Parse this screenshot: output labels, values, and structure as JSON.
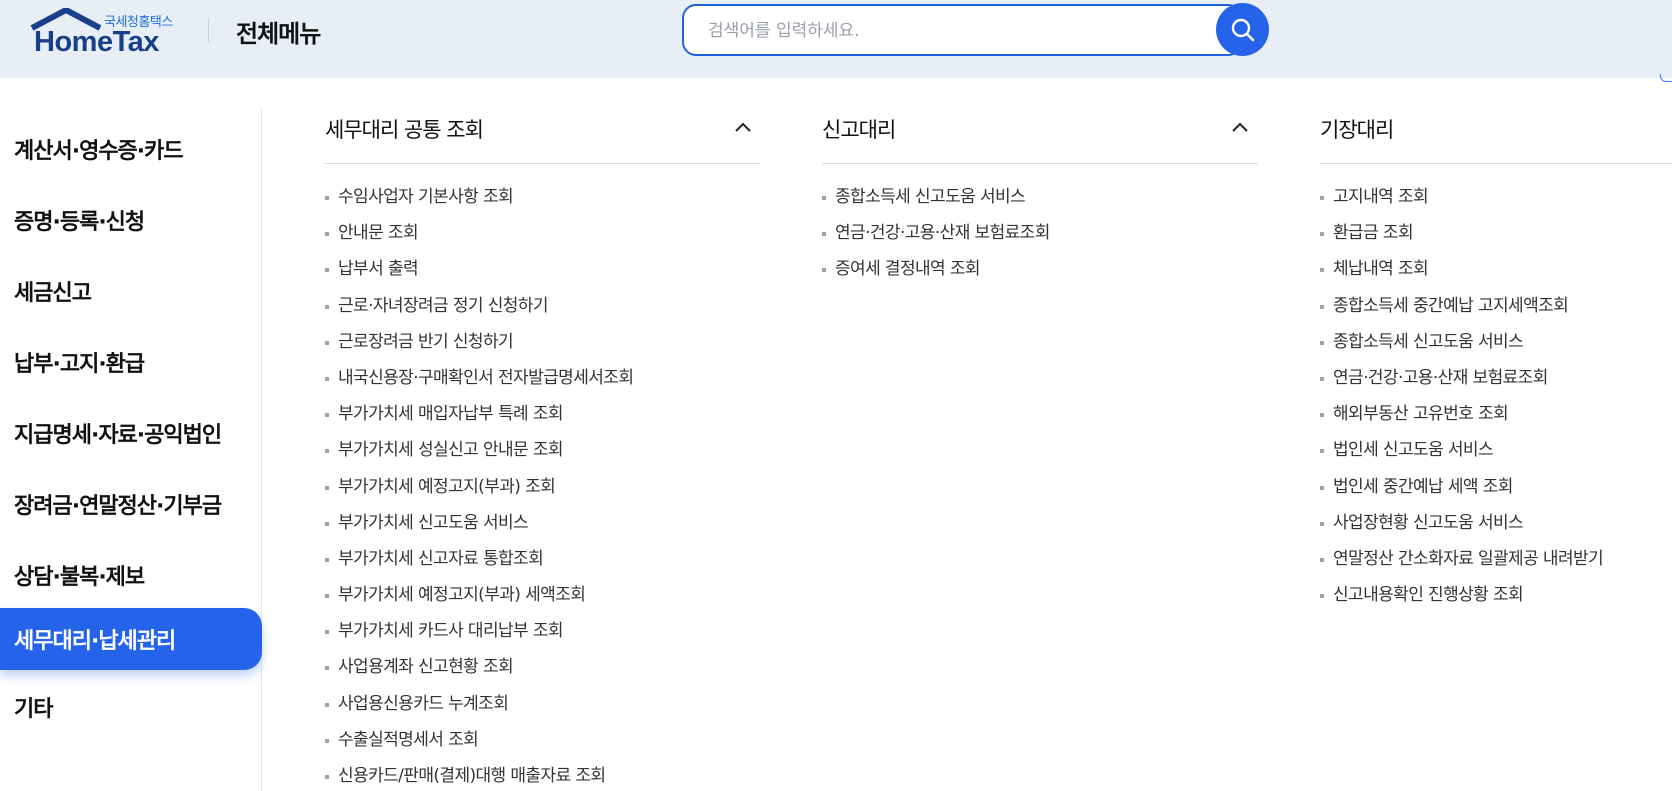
{
  "header": {
    "logo_sub": "국세청홈택스",
    "logo_main": "HomeTax",
    "title": "전체메뉴",
    "search_placeholder": "검색어를 입력하세요.",
    "search_icon": "search-icon"
  },
  "nav": {
    "items": [
      {
        "label": "계산서·영수증·카드"
      },
      {
        "label": "증명·등록·신청"
      },
      {
        "label": "세금신고"
      },
      {
        "label": "납부·고지·환급"
      },
      {
        "label": "지급명세·자료·공익법인"
      },
      {
        "label": "장려금·연말정산·기부금"
      },
      {
        "label": "상담·불복·제보"
      },
      {
        "label": "세무대리·납세관리",
        "active": true
      },
      {
        "label": "기타"
      }
    ],
    "active_color": "#2563eb"
  },
  "columns": [
    {
      "title": "세무대리 공통 조회",
      "expanded": true,
      "items": [
        "수임사업자 기본사항 조회",
        "안내문 조회",
        "납부서 출력",
        "근로·자녀장려금 정기 신청하기",
        "근로장려금 반기 신청하기",
        "내국신용장·구매확인서 전자발급명세서조회",
        "부가가치세 매입자납부 특례 조회",
        "부가가치세 성실신고 안내문 조회",
        "부가가치세 예정고지(부과) 조회",
        "부가가치세 신고도움 서비스",
        "부가가치세 신고자료 통합조회",
        "부가가치세 예정고지(부과) 세액조회",
        "부가가치세 카드사 대리납부 조회",
        "사업용계좌 신고현황 조회",
        "사업용신용카드 누계조회",
        "수출실적명세서 조회",
        "신용카드/판매(결제)대행 매출자료 조회"
      ]
    },
    {
      "title": "신고대리",
      "expanded": true,
      "items": [
        "종합소득세 신고도움 서비스",
        "연금·건강·고용·산재 보험료조회",
        "증여세 결정내역 조회"
      ]
    },
    {
      "title": "기장대리",
      "items": [
        "고지내역 조회",
        "환급금 조회",
        "체납내역 조회",
        "종합소득세 중간예납 고지세액조회",
        "종합소득세 신고도움 서비스",
        "연금·건강·고용·산재 보험료조회",
        "해외부동산 고유번호 조회",
        "법인세 신고도움 서비스",
        "법인세 중간예납 세액 조회",
        "사업장현황 신고도움 서비스",
        "연말정산 간소화자료 일괄제공 내려받기",
        "신고내용확인 진행상황 조회"
      ]
    }
  ]
}
